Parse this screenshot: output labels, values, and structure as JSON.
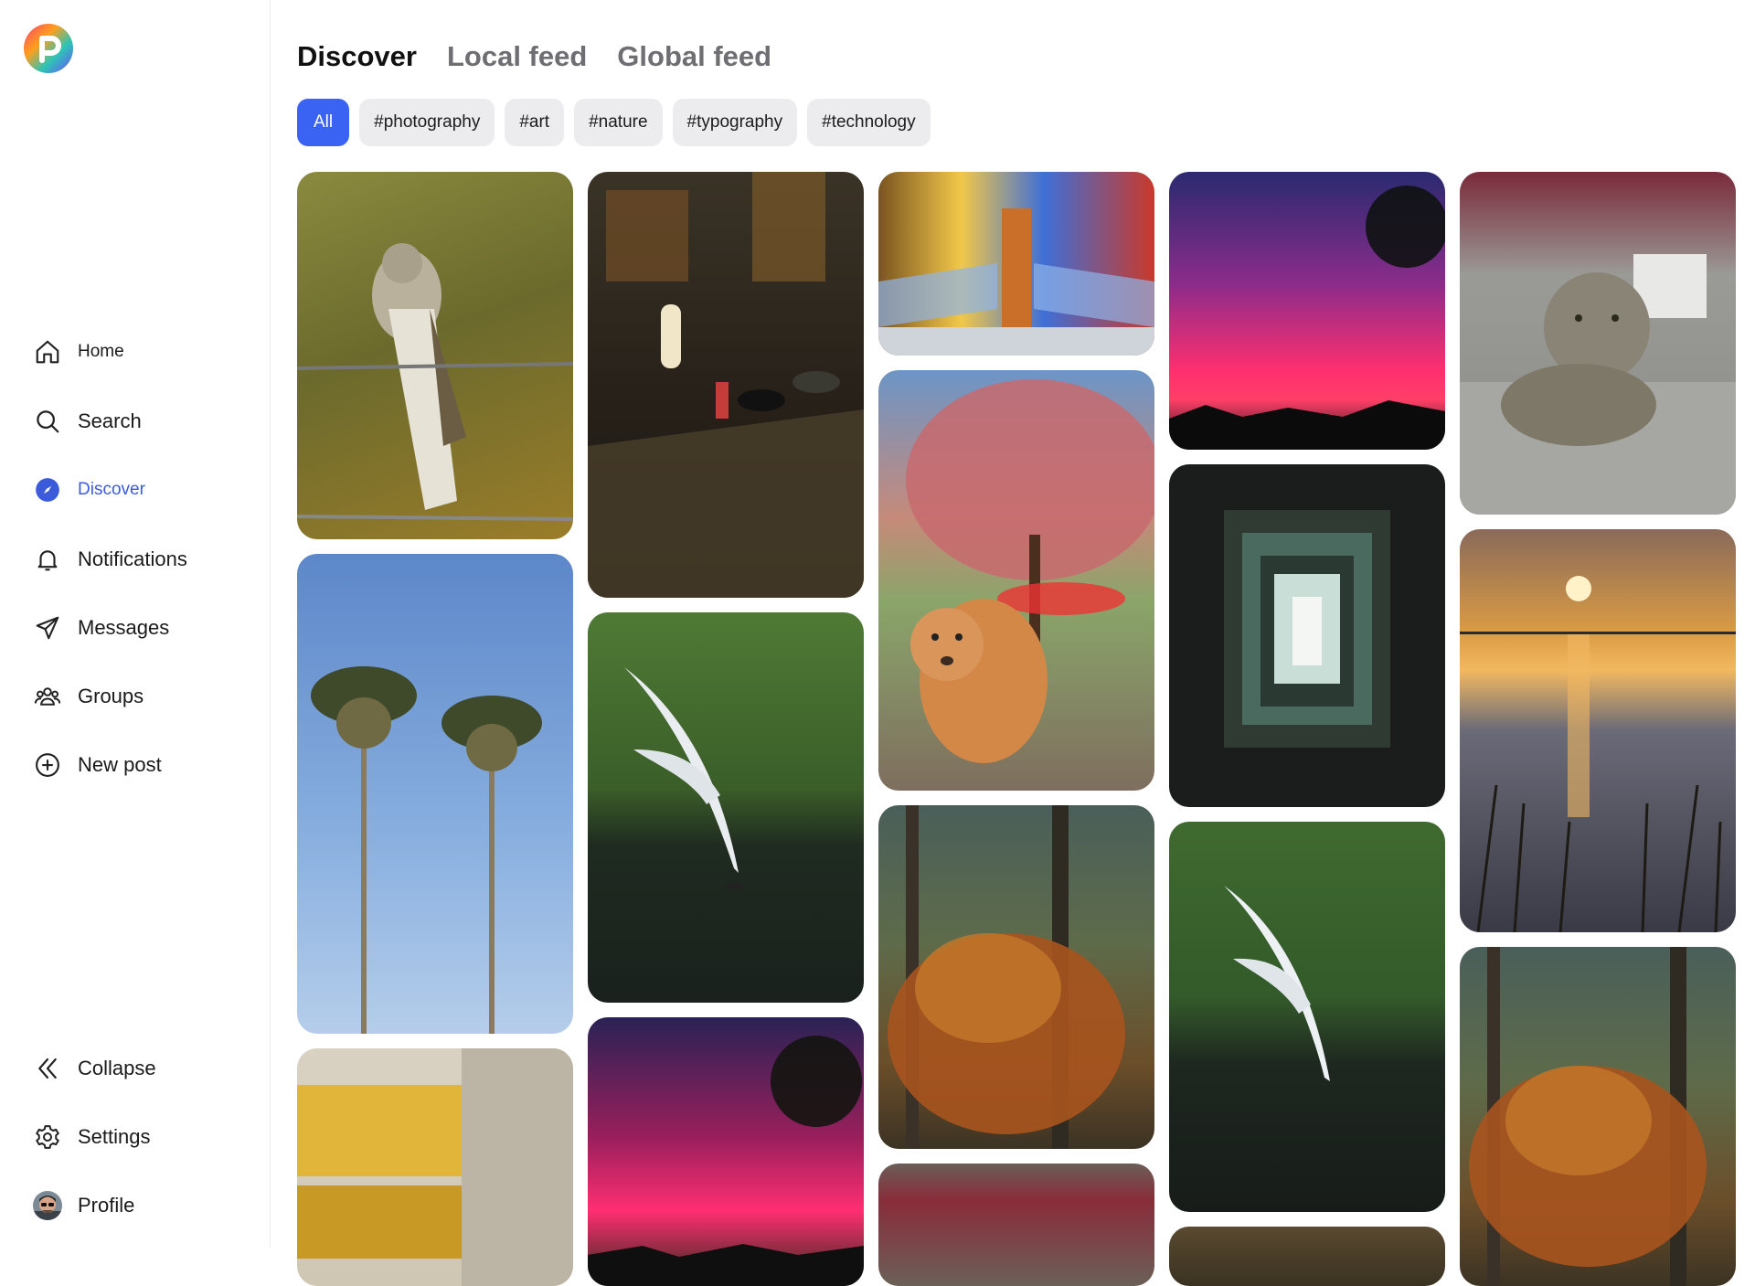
{
  "colors": {
    "accent": "#3a63f3",
    "nav_active": "#3b5bdb",
    "chip_bg": "#ececee",
    "tab_inactive": "#6e6e73"
  },
  "sidebar": {
    "logo_icon": "app-logo",
    "nav": [
      {
        "id": "home",
        "label": "Home",
        "icon": "home-icon"
      },
      {
        "id": "search",
        "label": "Search",
        "icon": "search-icon"
      },
      {
        "id": "discover",
        "label": "Discover",
        "icon": "compass-icon",
        "active": true
      },
      {
        "id": "notifications",
        "label": "Notifications",
        "icon": "bell-icon"
      },
      {
        "id": "messages",
        "label": "Messages",
        "icon": "send-icon"
      },
      {
        "id": "groups",
        "label": "Groups",
        "icon": "groups-icon"
      },
      {
        "id": "new_post",
        "label": "New post",
        "icon": "plus-circle-icon"
      }
    ],
    "bottom": [
      {
        "id": "collapse",
        "label": "Collapse",
        "icon": "double-chevron-left-icon"
      },
      {
        "id": "settings",
        "label": "Settings",
        "icon": "gear-icon"
      },
      {
        "id": "profile",
        "label": "Profile",
        "icon": "avatar"
      }
    ]
  },
  "main": {
    "tabs": [
      {
        "label": "Discover",
        "active": true
      },
      {
        "label": "Local feed"
      },
      {
        "label": "Global feed"
      }
    ],
    "chips": [
      {
        "label": "All",
        "active": true
      },
      {
        "label": "#photography"
      },
      {
        "label": "#art"
      },
      {
        "label": "#nature"
      },
      {
        "label": "#typography"
      },
      {
        "label": "#technology"
      }
    ],
    "photos": [
      {
        "subject": "bird-on-barbed-wire"
      },
      {
        "subject": "palm-trees-sky"
      },
      {
        "subject": "building-lit-windows"
      },
      {
        "subject": "rainy-night-street"
      },
      {
        "subject": "gull-over-water"
      },
      {
        "subject": "aurora-silhouette"
      },
      {
        "subject": "subway-tunnel"
      },
      {
        "subject": "dog-under-blossom-tree"
      },
      {
        "subject": "autumn-forest"
      },
      {
        "subject": "blurred-storefront"
      },
      {
        "subject": "aurora-silhouette"
      },
      {
        "subject": "stairwell-from-below"
      },
      {
        "subject": "gull-over-water"
      },
      {
        "subject": "night-street-crop"
      },
      {
        "subject": "cat-on-stone"
      },
      {
        "subject": "sunset-lake-reeds"
      },
      {
        "subject": "autumn-forest"
      }
    ]
  }
}
